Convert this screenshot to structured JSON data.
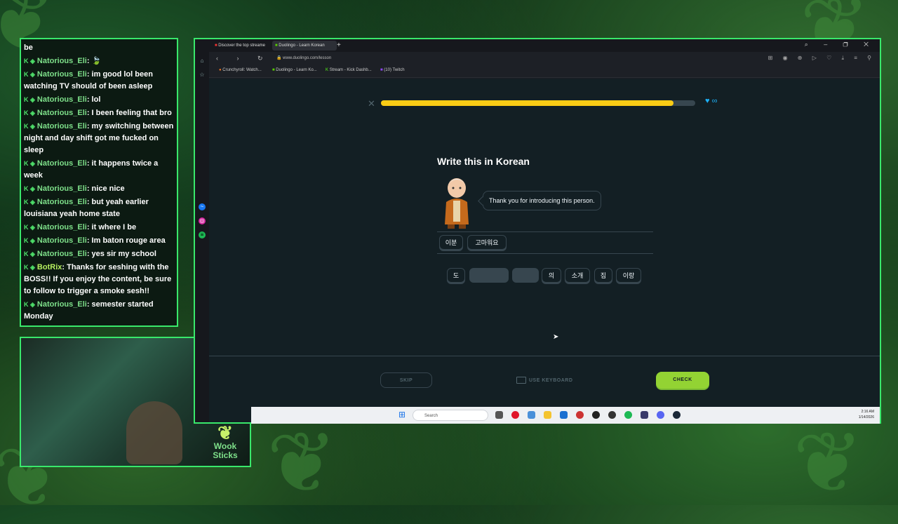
{
  "chat": {
    "messages": [
      {
        "user": "",
        "text": "be"
      },
      {
        "user": "Natorious_Eli",
        "text": ": 🍃"
      },
      {
        "user": "Natorious_Eli",
        "text": ": im good lol been watching TV should of been asleep"
      },
      {
        "user": "Natorious_Eli",
        "text": ": lol"
      },
      {
        "user": "Natorious_Eli",
        "text": ": I been feeling that bro"
      },
      {
        "user": "Natorious_Eli",
        "text": ": my switching between night and day shift got me fucked on sleep"
      },
      {
        "user": "Natorious_Eli",
        "text": ": it happens twice a week"
      },
      {
        "user": "Natorious_Eli",
        "text": ": nice nice"
      },
      {
        "user": "Natorious_Eli",
        "text": ": but yeah earlier louisiana yeah home state"
      },
      {
        "user": "Natorious_Eli",
        "text": ": it where I be"
      },
      {
        "user": "Natorious_Eli",
        "text": ": Im baton rouge area"
      },
      {
        "user": "Natorious_Eli",
        "text": ": yes sir my school"
      },
      {
        "user": "BotRix",
        "text": ": Thanks for seshing with the BOSS!! If you enjoy the content, be sure to follow to trigger a smoke sesh!!"
      },
      {
        "user": "Natorious_Eli",
        "text": ": semester started Monday"
      }
    ]
  },
  "webcam": {
    "logo_line1": "Wook",
    "logo_line2": "Sticks"
  },
  "browser": {
    "tabs": [
      "Discover the top streame",
      "Duolingo - Learn Korean"
    ],
    "url": "www.duolingo.com/lesson",
    "bookmarks": [
      "Crunchyroll: Watch...",
      "Duolingo - Learn Ko...",
      "Stream - Kick Dashb...",
      "(10) Twitch"
    ]
  },
  "lesson": {
    "progress": 0.93,
    "hearts": "∞",
    "prompt_title": "Write this in Korean",
    "sentence": "Thank you for introducing this person.",
    "answer_words": [
      "이분",
      "고마워요"
    ],
    "word_bank": [
      {
        "text": "도",
        "used": false
      },
      {
        "text": "",
        "used": true
      },
      {
        "text": "",
        "used": true
      },
      {
        "text": "의",
        "used": false
      },
      {
        "text": "소개",
        "used": false
      },
      {
        "text": "집",
        "used": false
      },
      {
        "text": "이랑",
        "used": false
      }
    ],
    "skip_label": "SKIP",
    "keyboard_label": "USE KEYBOARD",
    "check_label": "CHECK"
  },
  "taskbar": {
    "search_placeholder": "Search",
    "time": "2:16 AM",
    "date": "1/14/2026"
  },
  "colors": {
    "accent": "#39e86b",
    "progress": "#facc15",
    "check": "#93d333",
    "hearts": "#1cb0f6"
  }
}
